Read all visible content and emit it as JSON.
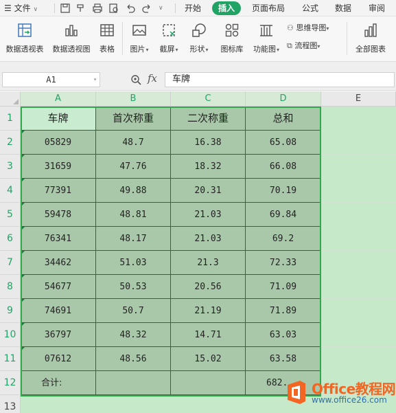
{
  "menu": {
    "file": "文件",
    "tabs": [
      "开始",
      "插入",
      "页面布局",
      "公式",
      "数据",
      "审阅"
    ],
    "active_tab": "插入"
  },
  "ribbon": {
    "pivot_table": "数据透视表",
    "pivot_chart": "数据透视图",
    "table": "表格",
    "picture": "图片",
    "screenshot": "截屏",
    "shape": "形状",
    "icon_library": "图标库",
    "function_chart": "功能图",
    "mind_map": "思维导图",
    "flowchart": "流程图",
    "all_charts": "全部图表"
  },
  "formula_bar": {
    "name_box": "A1",
    "fx": "fx",
    "content": "车牌"
  },
  "sheet": {
    "columns": [
      "A",
      "B",
      "C",
      "D",
      "E"
    ],
    "rows": [
      "1",
      "2",
      "3",
      "4",
      "5",
      "6",
      "7",
      "8",
      "9",
      "10",
      "11",
      "12",
      "13"
    ],
    "header": [
      "车牌",
      "首次称重",
      "二次称重",
      "总和"
    ],
    "data": [
      [
        "05829",
        "48.7",
        "16.38",
        "65.08"
      ],
      [
        "31659",
        "47.76",
        "18.32",
        "66.08"
      ],
      [
        "77391",
        "49.88",
        "20.31",
        "70.19"
      ],
      [
        "59478",
        "48.81",
        "21.03",
        "69.84"
      ],
      [
        "76341",
        "48.17",
        "21.03",
        "69.2"
      ],
      [
        "34462",
        "51.03",
        "21.3",
        "72.33"
      ],
      [
        "54677",
        "50.53",
        "20.56",
        "71.09"
      ],
      [
        "74691",
        "50.7",
        "21.19",
        "71.89"
      ],
      [
        "36797",
        "48.32",
        "14.71",
        "63.03"
      ],
      [
        "07612",
        "48.56",
        "15.02",
        "63.58"
      ]
    ],
    "total_label": "合计:",
    "total_value": "682.",
    "total_row": [
      "合计:",
      "",
      "",
      "682."
    ]
  },
  "watermark": {
    "brand": "Office教程网",
    "url": "www.office26.com"
  },
  "colors": {
    "accent": "#21a366",
    "selection_fill": "#a9c8a9",
    "grid_fill": "#c6e9c9",
    "outline": "#2eaa4a",
    "brand_orange": "#f26522"
  }
}
